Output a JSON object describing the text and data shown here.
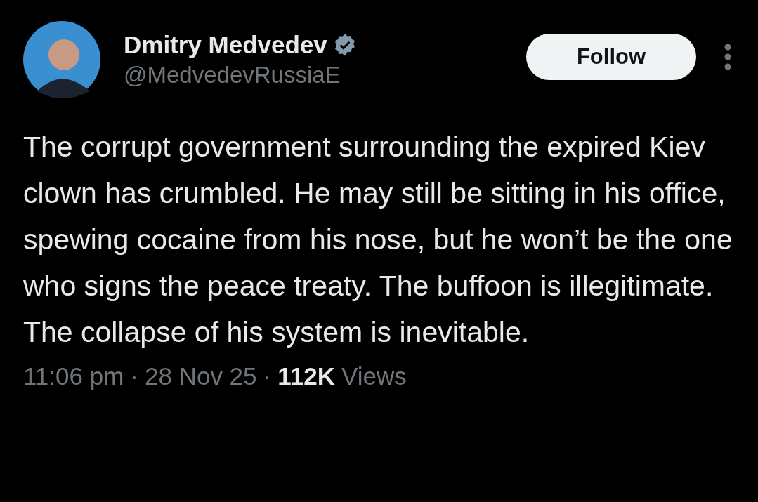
{
  "author": {
    "name": "Dmitry Medvedev",
    "verified": true,
    "handle": "@MedvedevRussiaE"
  },
  "follow_button": {
    "label": "Follow"
  },
  "text": "The corrupt government surrounding the expired Kiev clown has crumbled. He may still be sitting in his office, spewing cocaine from his nose, but he won’t be the one who signs the peace treaty. The buffoon is illegitimate. The collapse of his system is inevitable.",
  "meta": {
    "time": "11:06 pm",
    "separator": "·",
    "date": "28 Nov 25",
    "separator_2": "·",
    "views_count": "112K",
    "views_label": "Views"
  }
}
